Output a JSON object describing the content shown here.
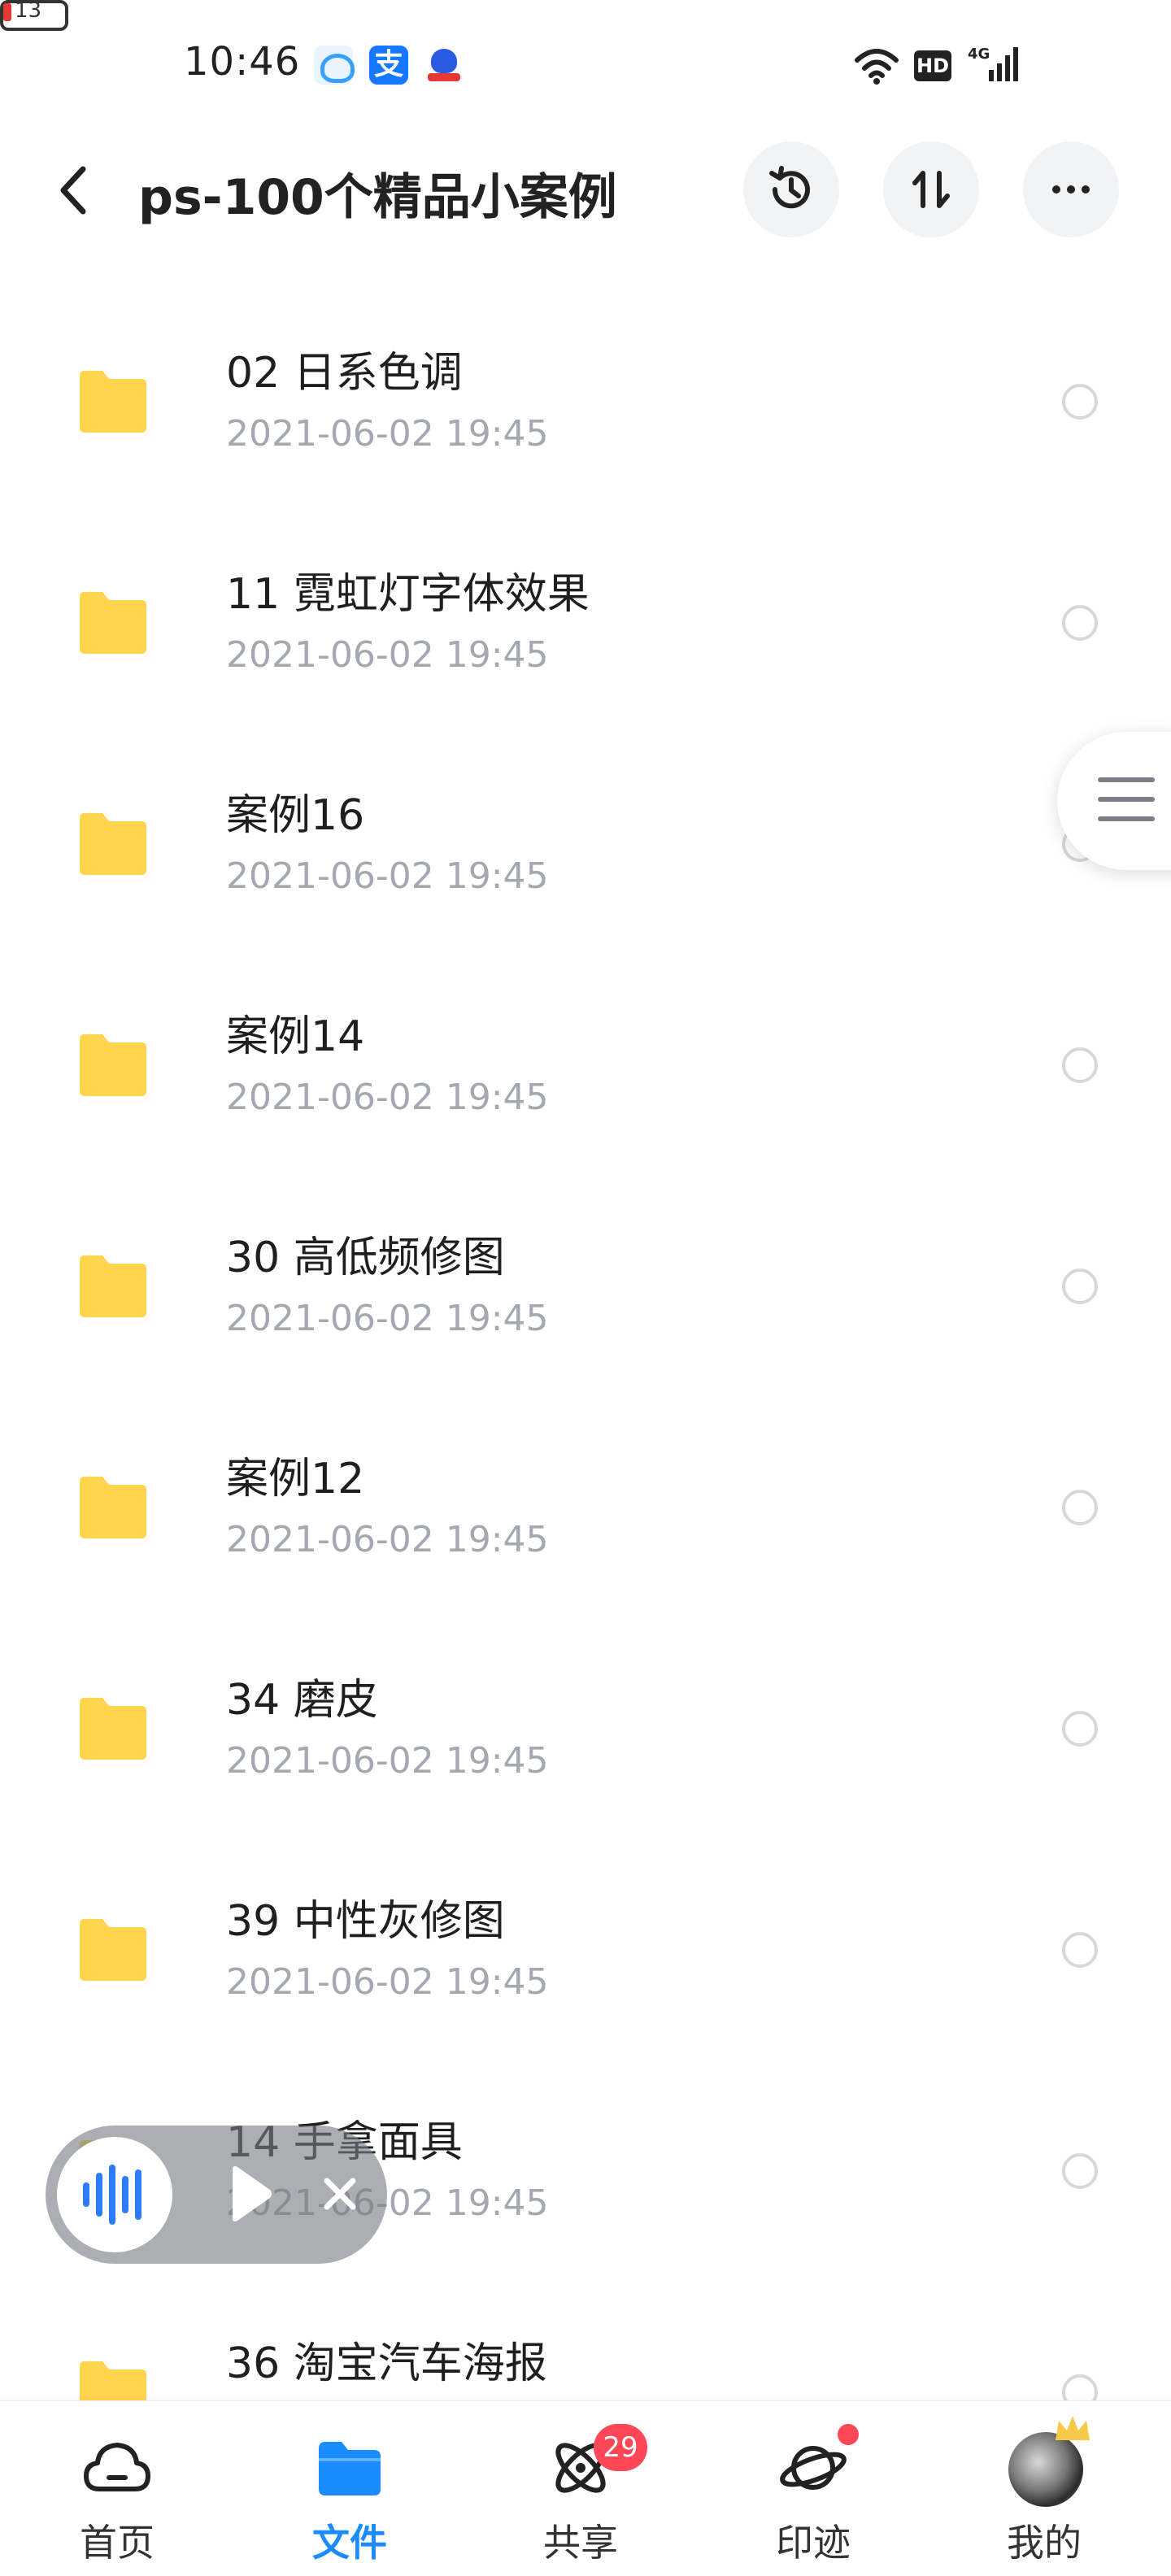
{
  "status_bar": {
    "time": "10:46",
    "network": "4G",
    "hd_label": "HD",
    "battery_level": "13",
    "battery_color": "#e53935"
  },
  "header": {
    "title": "ps-100个精品小案例",
    "back_icon": "chevron-left-icon",
    "actions": [
      "history-icon",
      "sort-icon",
      "more-icon"
    ]
  },
  "files": [
    {
      "name": "02 日系色调",
      "date": "2021-06-02  19:45"
    },
    {
      "name": "11 霓虹灯字体效果",
      "date": "2021-06-02  19:45"
    },
    {
      "name": "案例16",
      "date": "2021-06-02  19:45"
    },
    {
      "name": "案例14",
      "date": "2021-06-02  19:45"
    },
    {
      "name": "30 高低频修图",
      "date": "2021-06-02  19:45"
    },
    {
      "name": "案例12",
      "date": "2021-06-02  19:45"
    },
    {
      "name": "34 磨皮",
      "date": "2021-06-02  19:45"
    },
    {
      "name": "39 中性灰修图",
      "date": "2021-06-02  19:45"
    },
    {
      "name": "14 手拿面具",
      "date": "2021-06-02  19:45"
    },
    {
      "name": "36 淘宝汽车海报",
      "date": ""
    }
  ],
  "audio_player": {
    "icons": [
      "audio-wave-icon",
      "play-icon",
      "close-icon"
    ]
  },
  "bottom_nav": {
    "items": [
      {
        "label": "首页",
        "icon": "cloud-home-icon",
        "active": false
      },
      {
        "label": "文件",
        "icon": "folder-icon",
        "active": true
      },
      {
        "label": "共享",
        "icon": "atom-share-icon",
        "active": false,
        "badge": "29"
      },
      {
        "label": "印迹",
        "icon": "planet-icon",
        "active": false,
        "dot": true
      },
      {
        "label": "我的",
        "icon": "avatar",
        "active": false
      }
    ]
  },
  "colors": {
    "accent": "#1a8cff",
    "folder": "#ffd54f",
    "badge": "#ff4757",
    "date_text": "#a4a8b0"
  }
}
